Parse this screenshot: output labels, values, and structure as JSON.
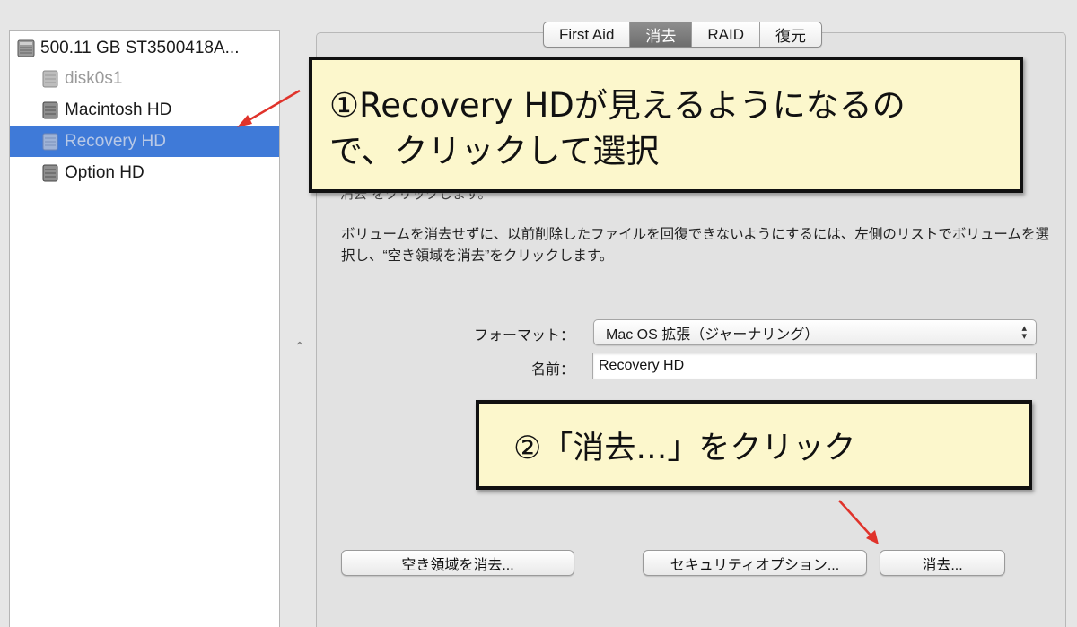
{
  "sidebar": {
    "items": [
      {
        "label": "500.11 GB ST3500418A...",
        "icon": "hard-disk-icon"
      },
      {
        "label": "disk0s1",
        "icon": "volume-icon"
      },
      {
        "label": "Macintosh HD",
        "icon": "volume-icon"
      },
      {
        "label": "Recovery HD",
        "icon": "volume-icon",
        "selected": true
      },
      {
        "label": "Option HD",
        "icon": "volume-icon"
      }
    ]
  },
  "splitter": {
    "glyph": "⌃"
  },
  "tabs": [
    {
      "label": "First Aid"
    },
    {
      "label": "消去",
      "active": true
    },
    {
      "label": "RAID"
    },
    {
      "label": "復元"
    }
  ],
  "panel": {
    "partial_line": "“消去”をクリックします。",
    "description": "ボリュームを消去せずに、以前削除したファイルを回復できないようにするには、左側のリストでボリュームを選択し、“空き領域を消去”をクリックします。",
    "format_label": "フォーマット：",
    "format_value": "Mac OS 拡張（ジャーナリング）",
    "name_label": "名前：",
    "name_value": "Recovery HD",
    "buttons": {
      "erase_free_space": "空き領域を消去...",
      "security_options": "セキュリティオプション...",
      "erase": "消去..."
    }
  },
  "annotations": {
    "callout1": {
      "line1": "①Recovery HDが見えるようになるの",
      "line2": "で、クリックして選択"
    },
    "callout2": "②「消去…」をクリック"
  },
  "colors": {
    "selection": "#3f7ad8",
    "callout_fill": "#fcf7cc",
    "arrow": "#e0332b"
  }
}
